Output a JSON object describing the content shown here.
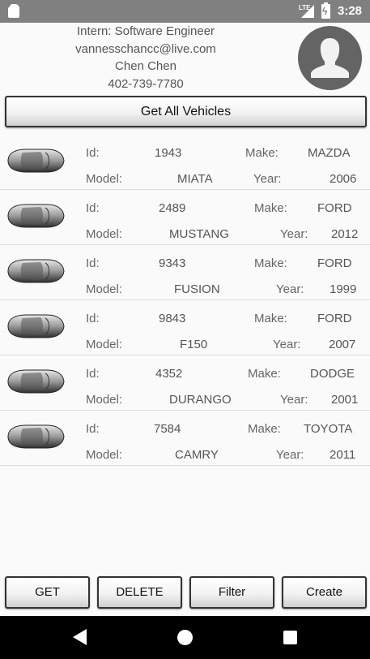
{
  "status_bar": {
    "network": "LTE",
    "time": "3:28",
    "icons": [
      "sd-card-icon",
      "signal-icon",
      "battery-charging-icon"
    ]
  },
  "profile": {
    "title": "Intern: Software Engineer",
    "email": "vannesschancc@live.com",
    "name": "Chen Chen",
    "phone": "402-739-7780",
    "avatar_icon": "person-avatar-icon"
  },
  "get_all_button": "Get All Vehicles",
  "labels": {
    "id": "Id:",
    "make": "Make:",
    "model": "Model:",
    "year": "Year:"
  },
  "vehicles": [
    {
      "id": "1943",
      "make": "MAZDA",
      "model": "MIATA",
      "year": "2006"
    },
    {
      "id": "2489",
      "make": "FORD",
      "model": "MUSTANG",
      "year": "2012"
    },
    {
      "id": "9343",
      "make": "FORD",
      "model": "FUSION",
      "year": "1999"
    },
    {
      "id": "9843",
      "make": "FORD",
      "model": "F150",
      "year": "2007"
    },
    {
      "id": "4352",
      "make": "DODGE",
      "model": "DURANGO",
      "year": "2001"
    },
    {
      "id": "7584",
      "make": "TOYOTA",
      "model": "CAMRY",
      "year": "2011"
    }
  ],
  "actions": {
    "get": "GET",
    "delete": "DELETE",
    "filter": "Filter",
    "create": "Create"
  },
  "nav": [
    "back-icon",
    "home-icon",
    "recents-icon"
  ]
}
